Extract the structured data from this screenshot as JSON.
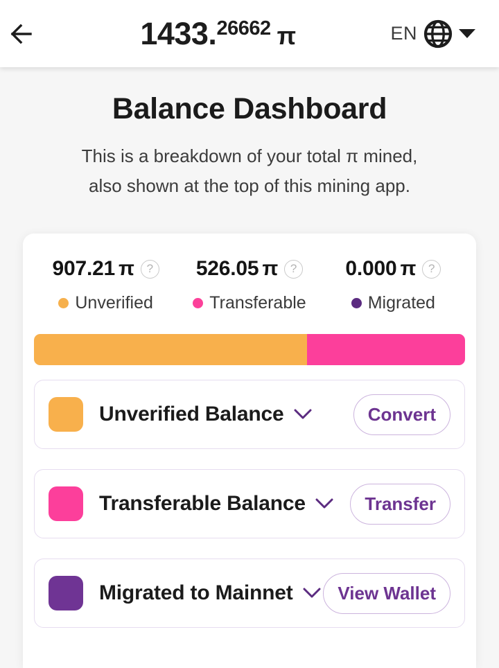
{
  "appbar": {
    "back_icon": "arrow-left-icon",
    "total_integer": "1433.",
    "total_fraction": "26662",
    "pi_symbol": "π",
    "language_code": "EN",
    "globe_icon": "globe-icon",
    "caret_icon": "chevron-down-icon"
  },
  "page": {
    "title": "Balance Dashboard",
    "subtitle_line1": "This is a breakdown of your total π mined,",
    "subtitle_line2": "also shown at the top of this mining app."
  },
  "summary": [
    {
      "amount": "907.21",
      "unit": "π",
      "help_icon": "question-mark-icon",
      "help_label": "?",
      "legend": "Unverified",
      "color": "#F6B04C"
    },
    {
      "amount": "526.05",
      "unit": "π",
      "help_icon": "question-mark-icon",
      "help_label": "?",
      "legend": "Transferable",
      "color": "#FC419A"
    },
    {
      "amount": "0.000",
      "unit": "π",
      "help_icon": "question-mark-icon",
      "help_label": "?",
      "legend": "Migrated",
      "color": "#5B2B80"
    }
  ],
  "progress_bar": {
    "segments": [
      {
        "name": "unverified",
        "color": "#F8B04C",
        "percent": 63.3
      },
      {
        "name": "transferable",
        "color": "#FC3F9B",
        "percent": 36.7
      }
    ]
  },
  "rows": [
    {
      "label": "Unverified Balance",
      "swatch_color": "#F8B04C",
      "chevron_icon": "chevron-down-icon",
      "button_label": "Convert"
    },
    {
      "label": "Transferable Balance",
      "swatch_color": "#FC3F9B",
      "chevron_icon": "chevron-down-icon",
      "button_label": "Transfer"
    },
    {
      "label": "Migrated to Mainnet",
      "swatch_color": "#6F3494",
      "chevron_icon": "chevron-down-icon",
      "button_label": "View Wallet"
    }
  ],
  "theme": {
    "accent_purple": "#6d3491",
    "page_background": "#f6f6f6",
    "card_background": "#ffffff"
  }
}
